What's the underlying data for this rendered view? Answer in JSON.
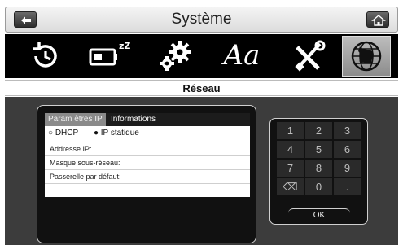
{
  "header": {
    "title": "Système",
    "back_icon": "back-arrow-icon",
    "home_icon": "home-icon"
  },
  "icon_bar": {
    "items": [
      {
        "icon": "clock-history-icon"
      },
      {
        "icon": "battery-sleep-icon",
        "glyph": "zZ"
      },
      {
        "icon": "gears-icon"
      },
      {
        "icon": "font-aa-icon",
        "glyph": "Aa"
      },
      {
        "icon": "tools-icon"
      },
      {
        "icon": "globe-network-icon",
        "selected": true
      }
    ]
  },
  "section": {
    "title": "Réseau"
  },
  "network": {
    "tabs": [
      {
        "label": "Param ètres IP",
        "active": true
      },
      {
        "label": "Informations",
        "active": false
      }
    ],
    "mode_options": [
      {
        "label": "DHCP",
        "selected": false
      },
      {
        "label": "IP statique",
        "selected": true
      }
    ],
    "fields": [
      {
        "label": "Addresse IP:"
      },
      {
        "label": "Masque sous-réseau:"
      },
      {
        "label": "Passerelle par défaut:"
      }
    ]
  },
  "keypad": {
    "keys": [
      "1",
      "2",
      "3",
      "4",
      "5",
      "6",
      "7",
      "8",
      "9",
      "⌫",
      "0",
      "."
    ],
    "ok_label": "OK"
  },
  "colors": {
    "background_dark": "#3c3c3c",
    "icon_bar": "#000000",
    "tab_active": "#8a8a8a"
  }
}
